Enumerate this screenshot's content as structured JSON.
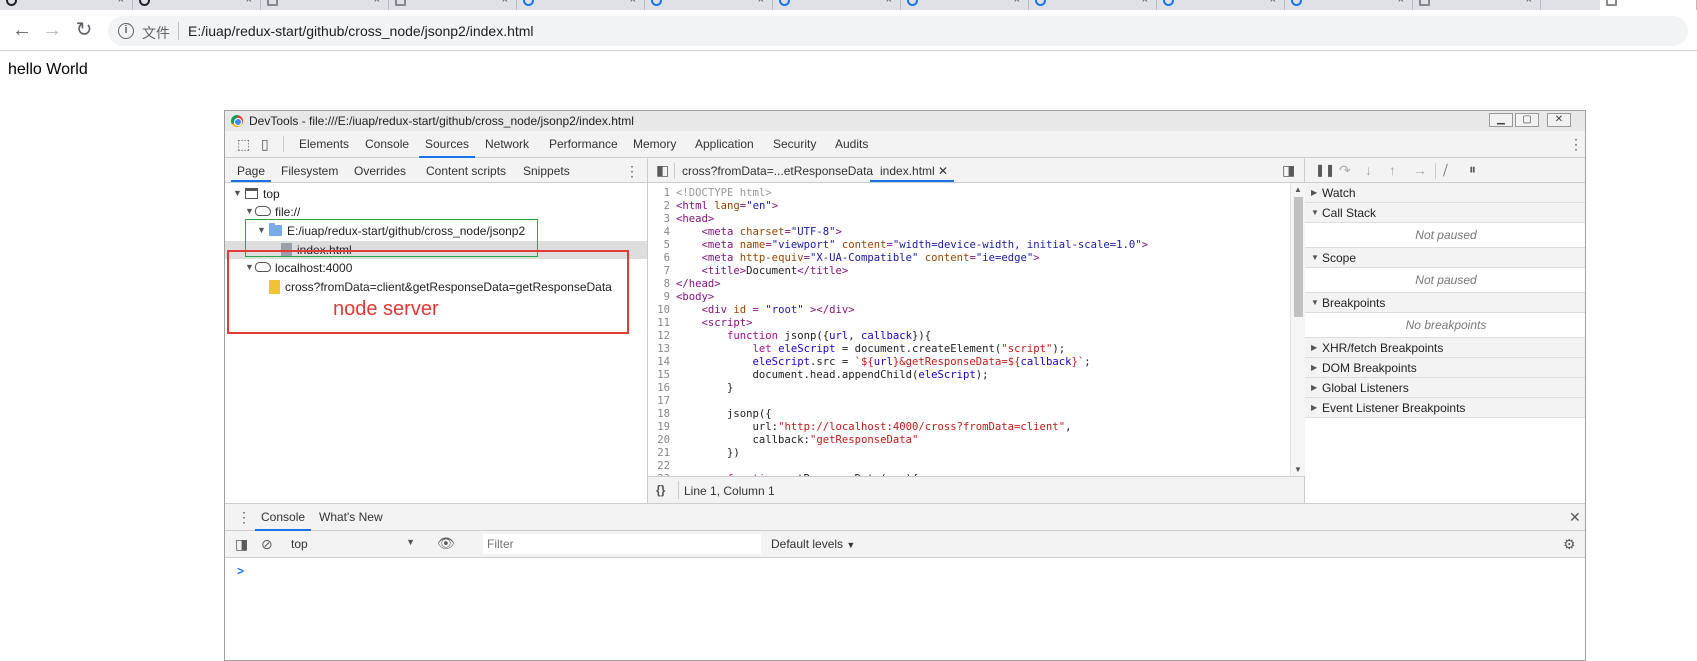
{
  "browser": {
    "url_scheme": "文件",
    "url": "E:/iuap/redux-start/github/cross_node/jsonp2/index.html",
    "nav": {
      "back": "←",
      "forward": "→",
      "reload": "↻"
    }
  },
  "page": {
    "text": "hello World"
  },
  "devtools": {
    "window_title": "DevTools - file:///E:/iuap/redux-start/github/cross_node/jsonp2/index.html",
    "main_tabs": [
      "Elements",
      "Console",
      "Sources",
      "Network",
      "Performance",
      "Memory",
      "Application",
      "Security",
      "Audits"
    ],
    "active_main_tab": "Sources",
    "navigator": {
      "tabs": [
        "Page",
        "Filesystem",
        "Overrides",
        "Content scripts",
        "Snippets"
      ],
      "tree": {
        "top": "top",
        "file_origin": "file://",
        "folder": "E:/iuap/redux-start/github/cross_node/jsonp2",
        "file": "index.html",
        "localhost": "localhost:4000",
        "request": "cross?fromData=client&getResponseData=getResponseData"
      },
      "annotation": "node server"
    },
    "editor": {
      "tabs": [
        "cross?fromData=...etResponseData",
        "index.html"
      ],
      "status": "Line 1, Column 1",
      "format_icon": "{}"
    },
    "sidebar": {
      "sections": [
        {
          "label": "Watch",
          "expanded": false
        },
        {
          "label": "Call Stack",
          "expanded": true,
          "body": "Not paused"
        },
        {
          "label": "Scope",
          "expanded": true,
          "body": "Not paused"
        },
        {
          "label": "Breakpoints",
          "expanded": true,
          "body": "No breakpoints"
        },
        {
          "label": "XHR/fetch Breakpoints",
          "expanded": false
        },
        {
          "label": "DOM Breakpoints",
          "expanded": false
        },
        {
          "label": "Global Listeners",
          "expanded": false
        },
        {
          "label": "Event Listener Breakpoints",
          "expanded": false
        }
      ]
    },
    "drawer": {
      "tabs": [
        "Console",
        "What's New"
      ],
      "context": "top",
      "filter_placeholder": "Filter",
      "levels": "Default levels",
      "prompt": ">"
    }
  }
}
